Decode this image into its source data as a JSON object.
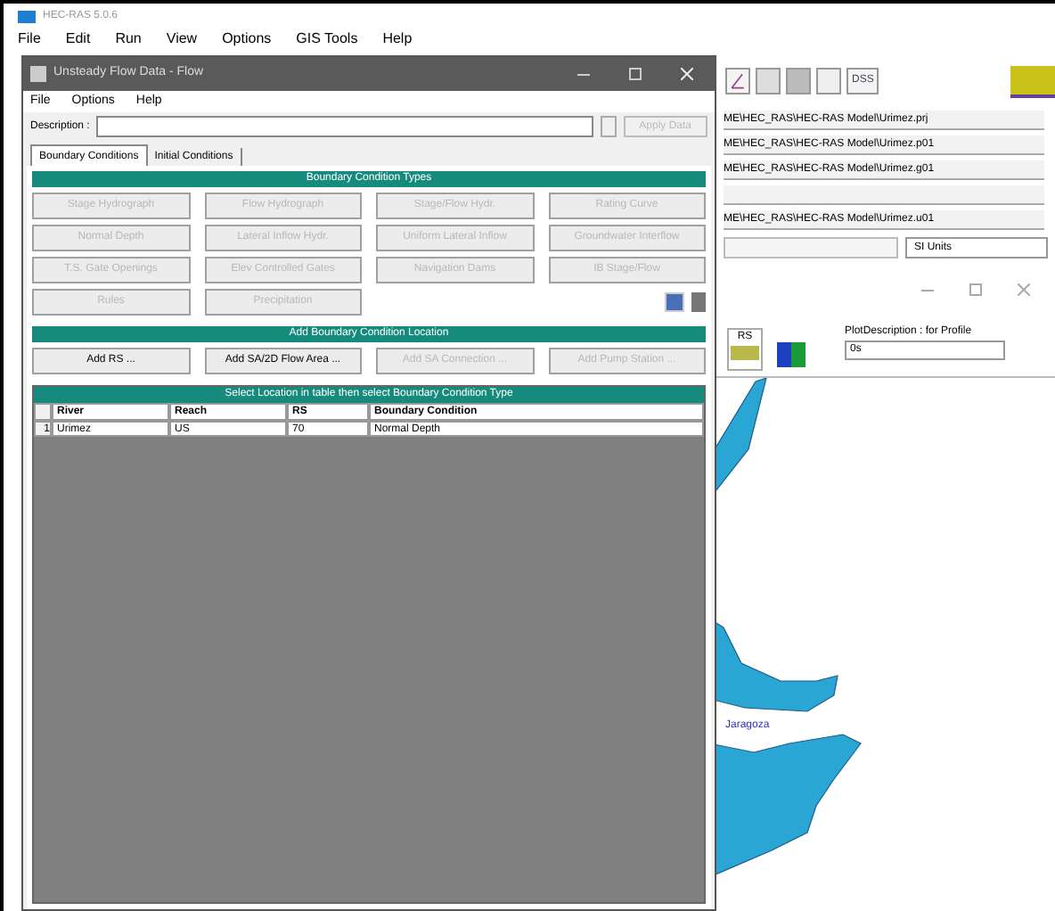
{
  "main_window": {
    "title": "HEC-RAS 5.0.6",
    "menu": [
      "File",
      "Edit",
      "Run",
      "View",
      "Options",
      "GIS Tools",
      "Help"
    ]
  },
  "toolbar": {
    "dss_label": "DSS"
  },
  "project_files": [
    {
      "kind": "path",
      "text": "ME\\HEC_RAS\\HEC-RAS Model\\Urimez.prj"
    },
    {
      "kind": "path",
      "text": "ME\\HEC_RAS\\HEC-RAS Model\\Urimez.p01"
    },
    {
      "kind": "path",
      "text": "ME\\HEC_RAS\\HEC-RAS Model\\Urimez.g01"
    },
    {
      "kind": "blank"
    },
    {
      "kind": "path",
      "text": "ME\\HEC_RAS\\HEC-RAS Model\\Urimez.u01"
    }
  ],
  "units": "SI Units",
  "plot_window": {
    "rs_label": "RS",
    "plot_description": "PlotDescription : for Profile",
    "profile_value": "0s",
    "map_label": "Jaragoza"
  },
  "dialog": {
    "title": "Unsteady Flow Data - Flow",
    "menu": [
      "File",
      "Options",
      "Help"
    ],
    "description_label": "Description :",
    "apply_button": {
      "label": "Apply Data",
      "disabled": true
    },
    "tabs": [
      {
        "label": "Boundary Conditions",
        "selected": true
      },
      {
        "label": "Initial Conditions",
        "selected": false
      }
    ],
    "bc_types": {
      "header": "Boundary Condition Types",
      "buttons": [
        {
          "label": "Stage Hydrograph",
          "disabled": true
        },
        {
          "label": "Flow Hydrograph",
          "disabled": true
        },
        {
          "label": "Stage/Flow Hydr.",
          "disabled": true
        },
        {
          "label": "Rating Curve",
          "disabled": true
        },
        {
          "label": "Normal Depth",
          "disabled": true
        },
        {
          "label": "Lateral Inflow Hydr.",
          "disabled": true
        },
        {
          "label": "Uniform Lateral Inflow",
          "disabled": true
        },
        {
          "label": "Groundwater Interflow",
          "disabled": true
        },
        {
          "label": "T.S. Gate Openings",
          "disabled": true
        },
        {
          "label": "Elev Controlled Gates",
          "disabled": true
        },
        {
          "label": "Navigation Dams",
          "disabled": true
        },
        {
          "label": "IB Stage/Flow",
          "disabled": true
        },
        {
          "label": "Rules",
          "disabled": true
        },
        {
          "label": "Precipitation",
          "disabled": true
        }
      ]
    },
    "add_location": {
      "header": "Add Boundary Condition Location",
      "buttons": [
        {
          "label": "Add RS ...",
          "disabled": false
        },
        {
          "label": "Add SA/2D Flow Area ...",
          "disabled": false
        },
        {
          "label": "Add SA Connection ...",
          "disabled": true
        },
        {
          "label": "Add Pump Station ...",
          "disabled": true
        }
      ]
    },
    "table": {
      "header": "Select Location in table then select Boundary Condition Type",
      "columns": [
        "River",
        "Reach",
        "RS",
        "Boundary Condition"
      ],
      "rows": [
        {
          "number": "1",
          "cells": [
            "Urimez",
            "US",
            "70",
            "Normal Depth"
          ]
        }
      ]
    }
  }
}
